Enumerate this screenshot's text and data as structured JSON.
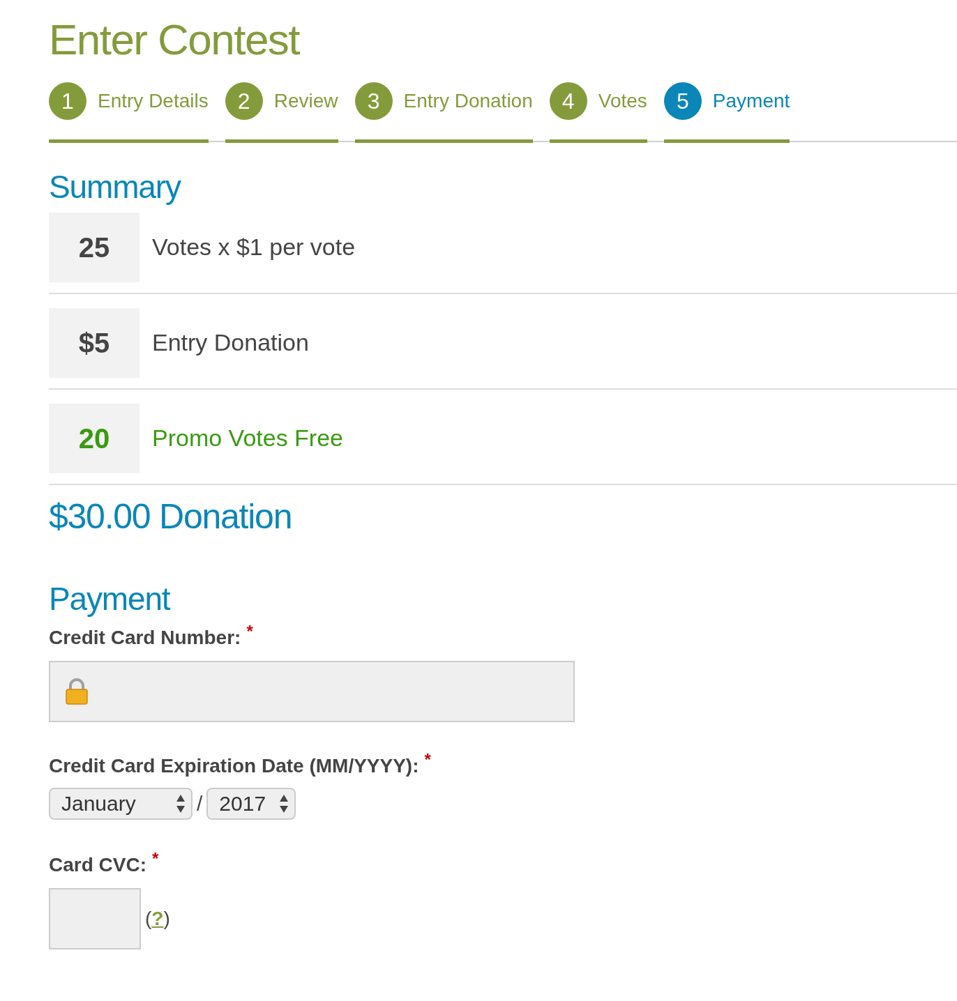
{
  "title": "Enter Contest",
  "steps": [
    {
      "number": "1",
      "label": "Entry Details",
      "selected": false
    },
    {
      "number": "2",
      "label": "Review",
      "selected": false
    },
    {
      "number": "3",
      "label": "Entry Donation",
      "selected": false
    },
    {
      "number": "4",
      "label": "Votes",
      "selected": false
    },
    {
      "number": "5",
      "label": "Payment",
      "selected": true
    }
  ],
  "summary": {
    "heading": "Summary",
    "rows": [
      {
        "kind": "charge",
        "amount": "25",
        "label": "Votes x $1 per vote"
      },
      {
        "kind": "charge",
        "amount": "$5",
        "label": "Entry Donation"
      },
      {
        "kind": "promo",
        "amount": "20",
        "label": "Promo Votes Free"
      }
    ]
  },
  "total": "$30.00 Donation",
  "payment": {
    "heading": "Payment",
    "card_number": {
      "label": "Credit Card Number:",
      "required_mark": "*"
    },
    "expiration": {
      "label": "Credit Card Expiration Date (MM/YYYY):",
      "required_mark": "*",
      "month": "January",
      "separator": "/",
      "year": "2017"
    },
    "cvc": {
      "label": "Card CVC:",
      "required_mark": "*",
      "help_open": "(",
      "help_link": "?",
      "help_close": ")"
    }
  }
}
